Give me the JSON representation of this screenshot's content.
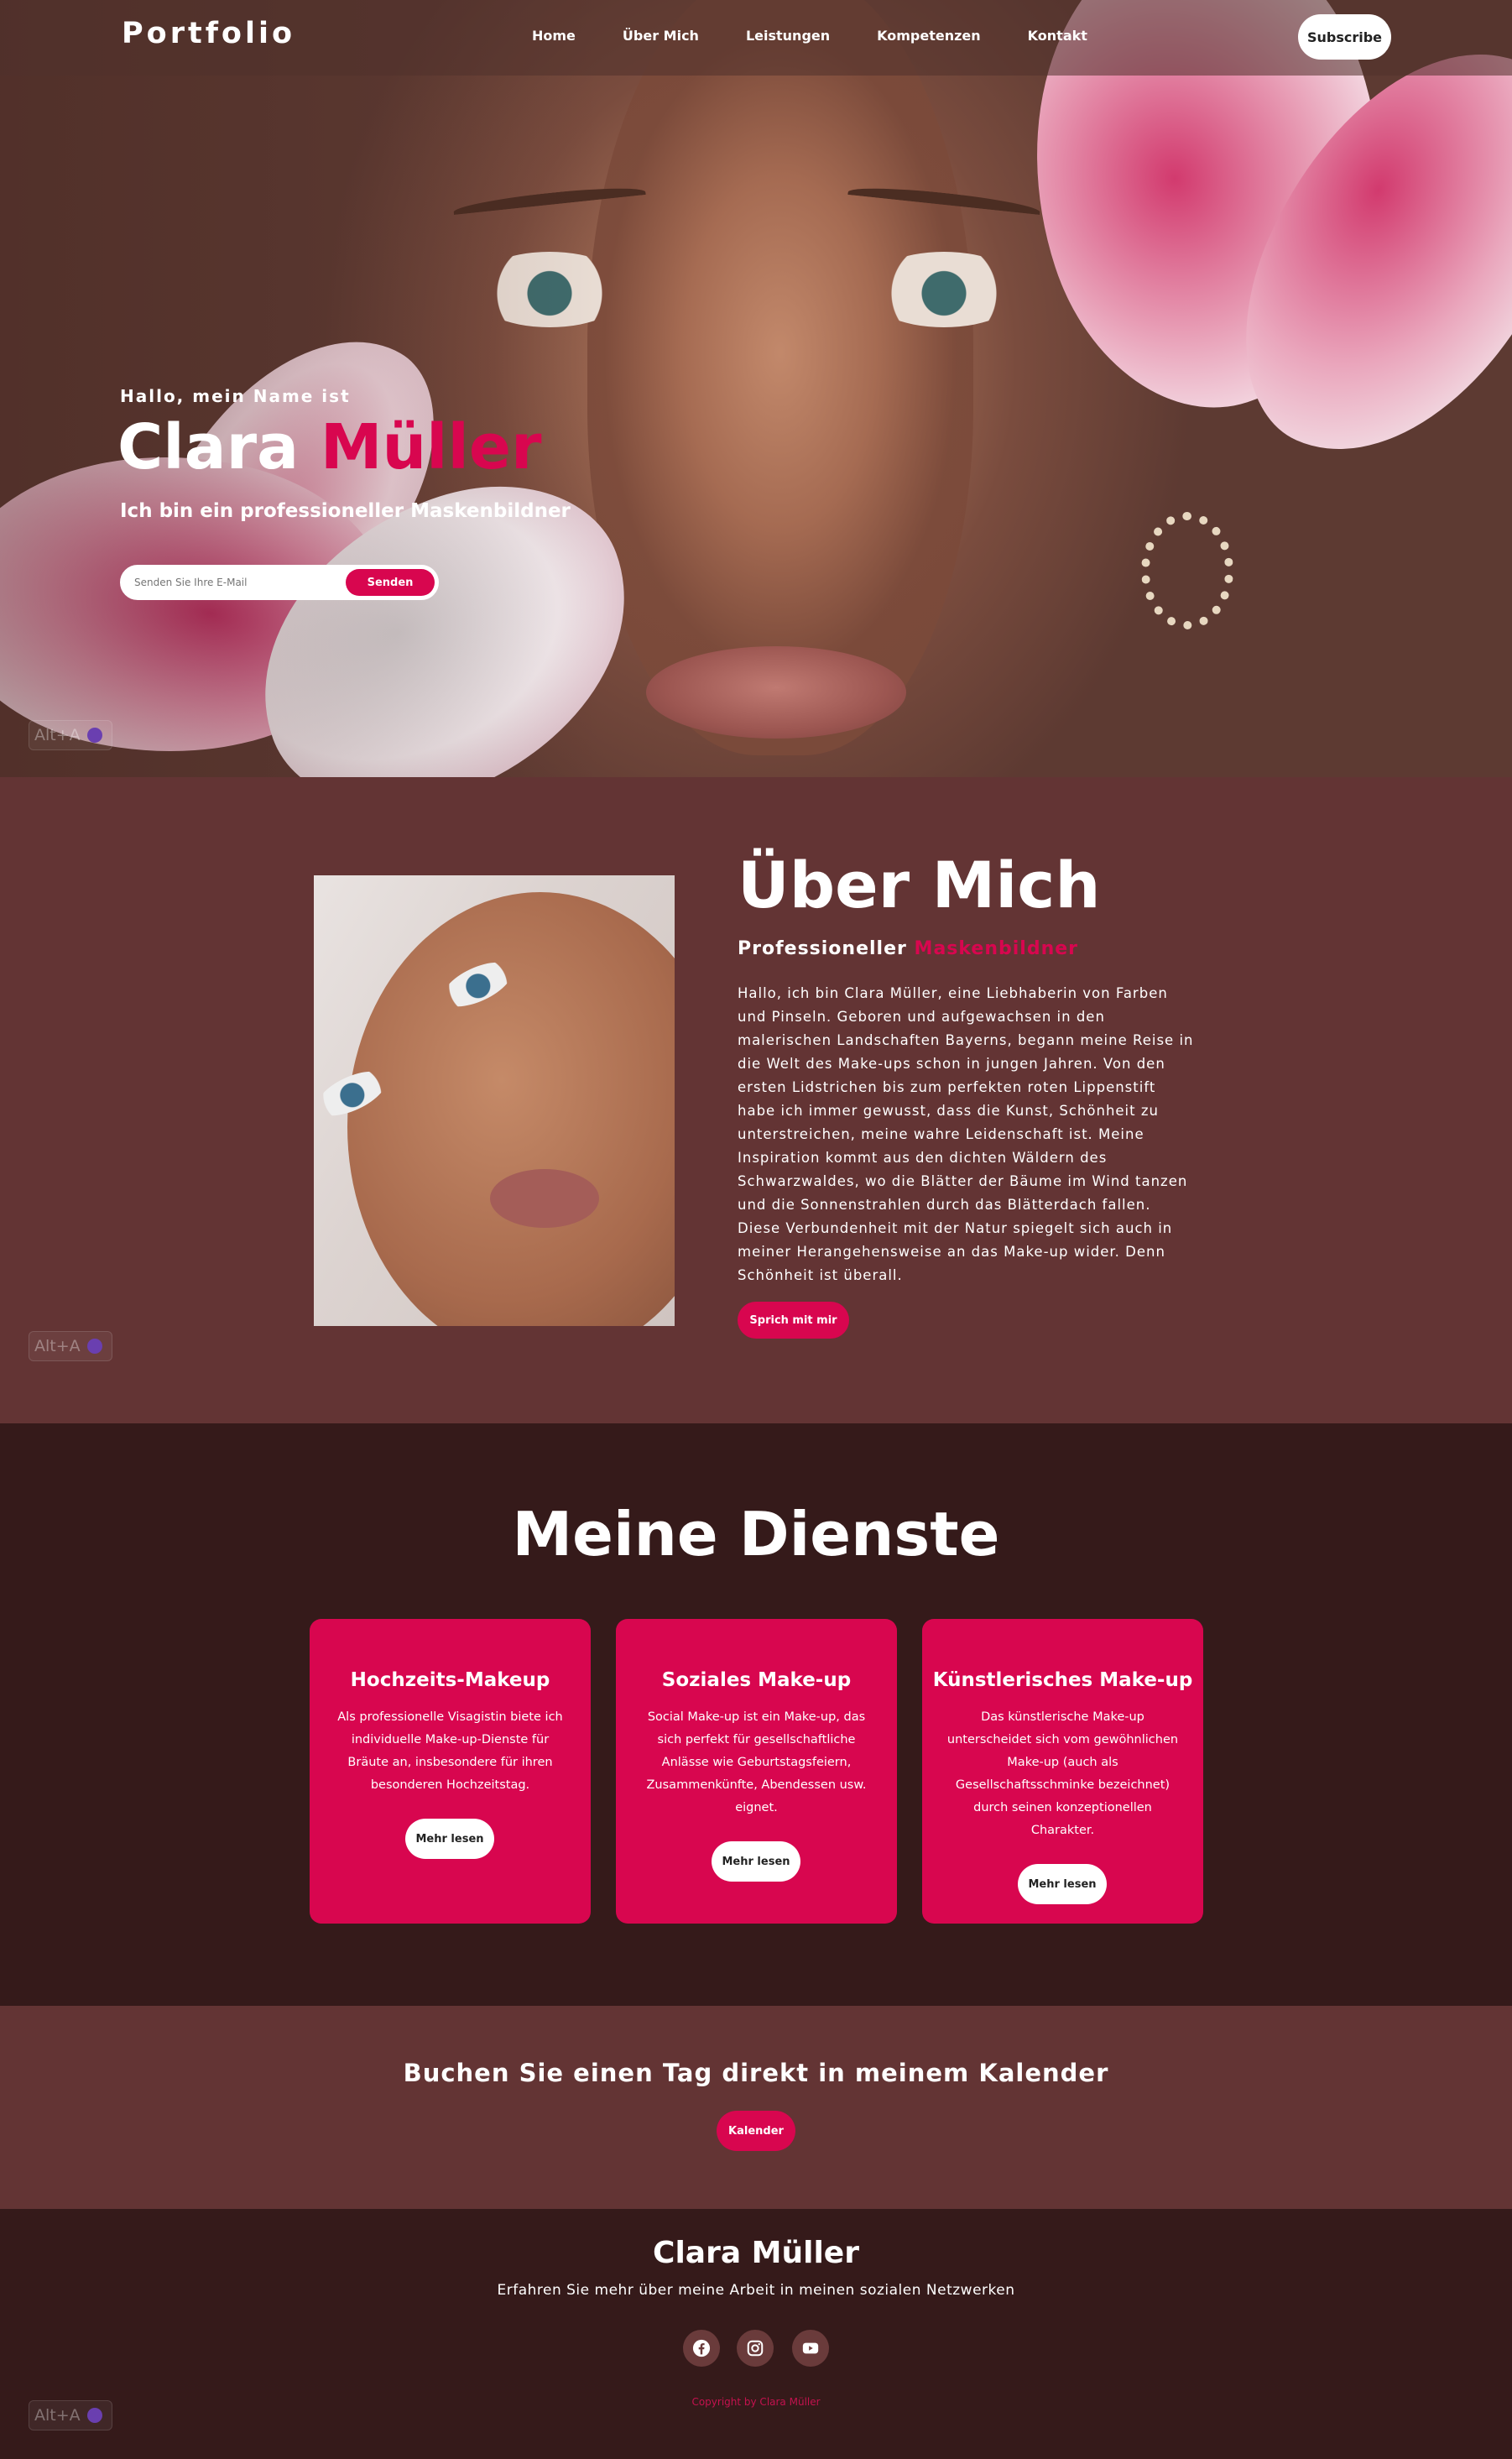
{
  "nav": {
    "logo": "Portfolio",
    "items": [
      "Home",
      "Über Mich",
      "Leistungen",
      "Kompetenzen",
      "Kontakt"
    ],
    "subscribe_label": "Subscribe"
  },
  "hero": {
    "greeting": "Hallo, mein Name ist",
    "first_name": "Clara",
    "last_name": "Müller",
    "tagline": "Ich bin ein professioneller Maskenbildner",
    "email_placeholder": "Senden Sie Ihre E-Mail",
    "send_label": "Senden"
  },
  "alt_badge": "Alt+A",
  "about": {
    "title": "Über Mich",
    "subtitle_plain": "Professioneller",
    "subtitle_accent": "Maskenbildner",
    "text": "Hallo, ich bin Clara Müller, eine Liebhaberin von Farben und Pinseln. Geboren und aufgewachsen in den malerischen Landschaften Bayerns, begann meine Reise in die Welt des Make-ups schon in jungen Jahren. Von den ersten Lidstrichen bis zum perfekten roten Lippenstift habe ich immer gewusst, dass die Kunst, Schönheit zu unterstreichen, meine wahre Leidenschaft ist. Meine Inspiration kommt aus den dichten Wäldern des Schwarzwaldes, wo die Blätter der Bäume im Wind tanzen und die Sonnenstrahlen durch das Blätterdach fallen. Diese Verbundenheit mit der Natur spiegelt sich auch in meiner Herangehensweise an das Make-up wider. Denn Schönheit ist überall.",
    "button_label": "Sprich mit mir"
  },
  "services": {
    "title": "Meine Dienste",
    "cards": [
      {
        "title": "Hochzeits-Makeup",
        "text": "Als professionelle Visagistin biete ich individuelle Make-up-Dienste für Bräute an, insbesondere für ihren besonderen Hochzeitstag.",
        "button_label": "Mehr lesen"
      },
      {
        "title": "Soziales Make-up",
        "text": "Social Make-up ist ein Make-up, das sich perfekt für gesellschaftliche Anlässe wie Geburtstagsfeiern, Zusammenkünfte, Abendessen usw. eignet.",
        "button_label": "Mehr lesen"
      },
      {
        "title": "Künstlerisches Make-up",
        "text": "Das künstlerische Make-up unterscheidet sich vom gewöhnlichen Make-up (auch als Gesellschaftsschminke bezeichnet) durch seinen konzeptionellen Charakter.",
        "button_label": "Mehr lesen"
      }
    ]
  },
  "calendar": {
    "title": "Buchen Sie einen Tag direkt in meinem Kalender",
    "button_label": "Kalender"
  },
  "footer": {
    "name": "Clara Müller",
    "subtitle": "Erfahren Sie mehr über meine Arbeit in meinen sozialen Netzwerken",
    "social_icons": [
      "facebook-icon",
      "instagram-icon",
      "youtube-icon"
    ],
    "copyright": "Copyright by Clara Müller"
  },
  "colors": {
    "accent": "#d8064f",
    "about_bg": "#633434",
    "dark_bg": "#351a1a"
  }
}
